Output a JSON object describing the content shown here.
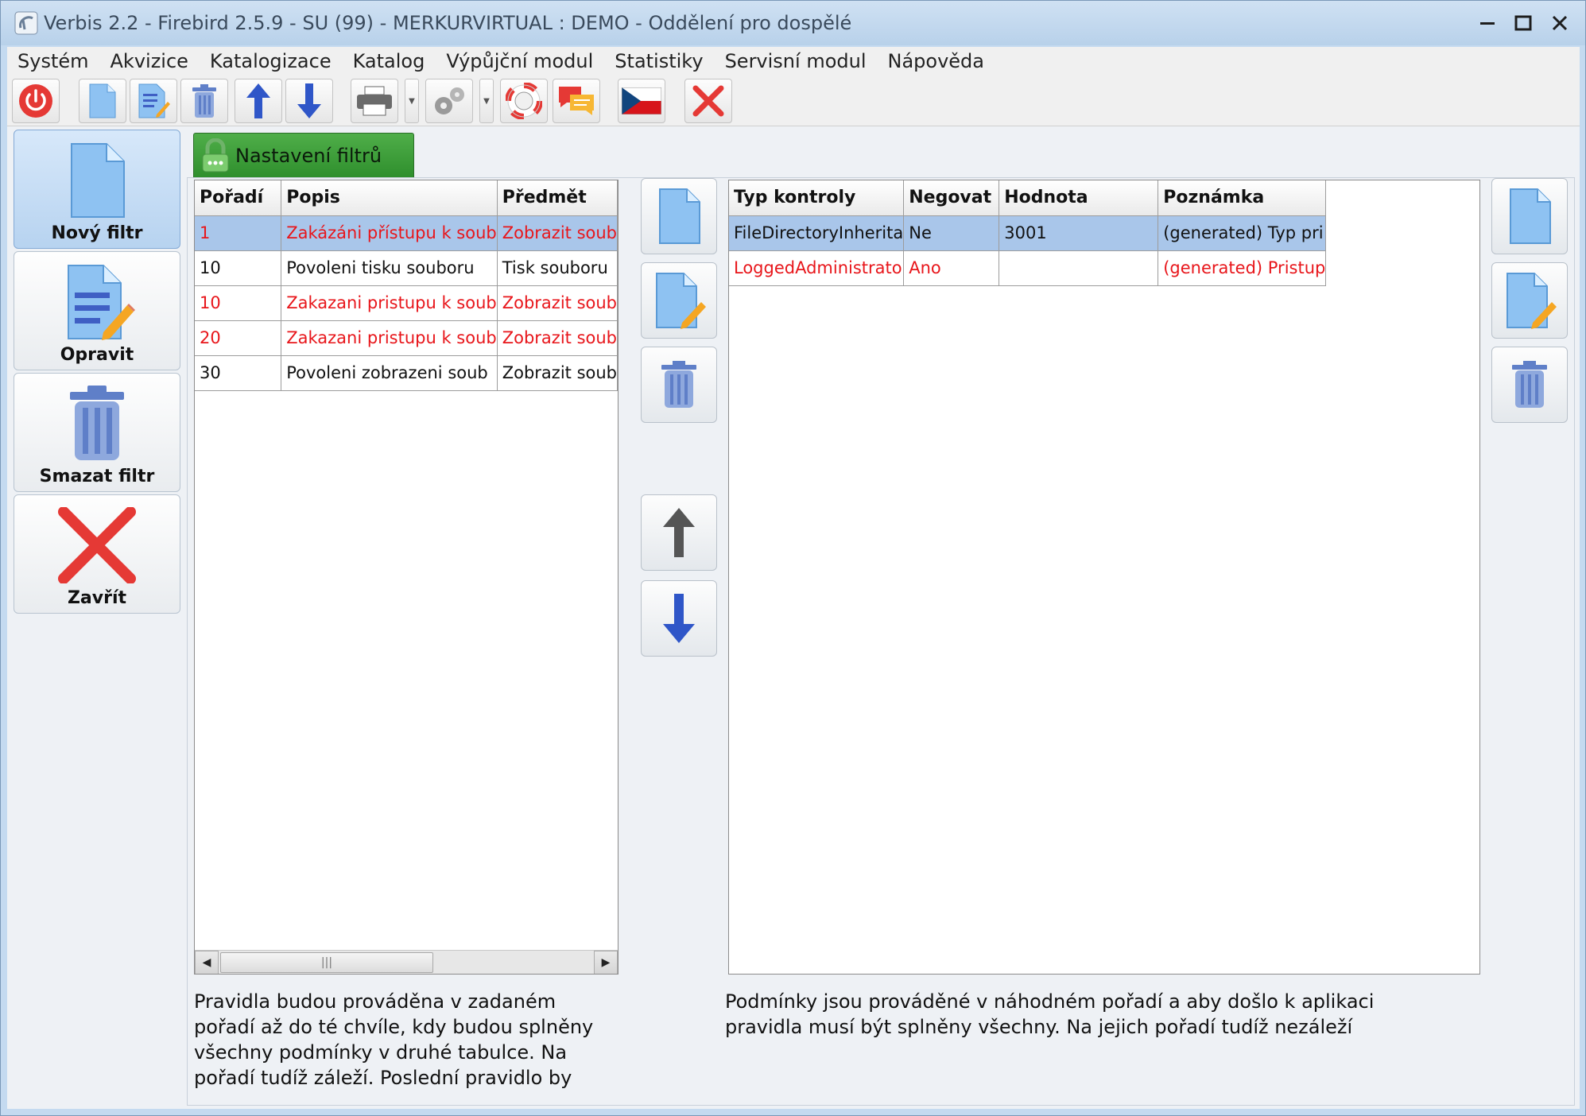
{
  "window": {
    "title": "Verbis 2.2 - Firebird 2.5.9 - SU (99) - MERKURVIRTUAL : DEMO - Oddělení pro dospělé"
  },
  "menu": [
    "Systém",
    "Akvizice",
    "Katalogizace",
    "Katalog",
    "Výpůjční modul",
    "Statistiky",
    "Servisní modul",
    "Nápověda"
  ],
  "sidebar": {
    "new_filter": "Nový filtr",
    "edit": "Opravit",
    "delete_filter": "Smazat filtr",
    "close": "Zavřít"
  },
  "tab": {
    "label": "Nastavení filtrů"
  },
  "rules_grid": {
    "columns": [
      "Pořadí",
      "Popis",
      "Předmět"
    ],
    "rows": [
      {
        "order": "1",
        "desc": "Zakázáni přístupu k soub",
        "subject": "Zobrazit soub"
      },
      {
        "order": "10",
        "desc": "Povoleni tisku souboru",
        "subject": "Tisk souboru"
      },
      {
        "order": "10",
        "desc": "Zakazani pristupu k soub",
        "subject": "Zobrazit soub"
      },
      {
        "order": "20",
        "desc": "Zakazani pristupu k soub",
        "subject": "Zobrazit soub"
      },
      {
        "order": "30",
        "desc": "Povoleni zobrazeni soub",
        "subject": "Zobrazit soub"
      }
    ],
    "scroll_grip": "|||"
  },
  "conditions_grid": {
    "columns": [
      "Typ kontroly",
      "Negovat",
      "Hodnota",
      "Poznámka"
    ],
    "rows": [
      {
        "type": "FileDirectoryInherita",
        "negate": "Ne",
        "value": "3001",
        "note": "(generated) Typ pri"
      },
      {
        "type": "LoggedAdministrato",
        "negate": "Ano",
        "value": "",
        "note": "(generated) Pristup"
      }
    ]
  },
  "notes": {
    "left": [
      "Pravidla budou prováděna v zadaném",
      "pořadí až do té chvíle, kdy budou splněny",
      "všechny podmínky v druhé tabulce. Na",
      "pořadí tudíž záleží. Poslední pravidlo by"
    ],
    "right": [
      "Podmínky jsou prováděné v náhodném pořadí a aby došlo k aplikaci",
      "pravidla musí být splněny všechny. Na jejich pořadí tudíž nezáleží"
    ]
  },
  "colors": {
    "red_text": "#e8161b",
    "selection": "#a9c6ea",
    "tab_green": "#3a9b36",
    "icon_blue": "#3f5fc4"
  }
}
